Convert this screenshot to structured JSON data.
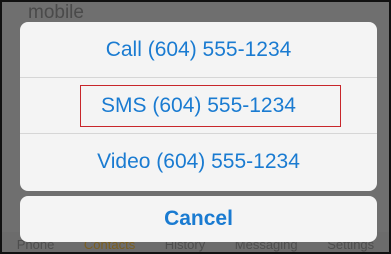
{
  "background": {
    "section_label": "mobile",
    "tabs": [
      "Phone",
      "Contacts",
      "History",
      "Messaging",
      "Settings"
    ]
  },
  "action_sheet": {
    "actions": [
      {
        "label": "Call (604) 555-1234"
      },
      {
        "label": "SMS (604) 555-1234",
        "highlighted": true
      },
      {
        "label": "Video (604) 555-1234"
      }
    ],
    "cancel_label": "Cancel"
  },
  "colors": {
    "action_text": "#1a7bd1",
    "highlight_border": "#c8262b",
    "dim_overlay": "#6f6f6f"
  }
}
